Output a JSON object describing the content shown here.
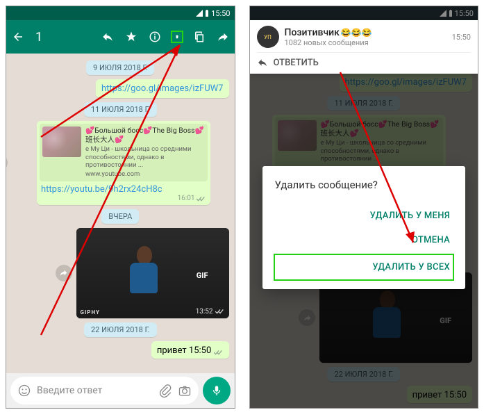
{
  "status": {
    "time": "15:50"
  },
  "appbar": {
    "selected_count": "1"
  },
  "dates": {
    "d1": "9 ИЮЛЯ 2018 Г.",
    "d2": "11 ИЮЛЯ 2018 Г.",
    "yesterday": "ВЧЕРА",
    "d3": "22 ИЮЛЯ 2018 Г."
  },
  "msgs": {
    "link1": "https://goo.gl/images/izFUW7",
    "preview": {
      "title": "💕Большой босс💕The Big Boss💕班长大人💕",
      "desc": "е Му Ци - школьница со средними способностями, однако в противостоянии ...",
      "site": "www.youtube.com",
      "link": "https://youtu.be/9h2rx24cH8c",
      "time": "16:01"
    },
    "gif": {
      "label": "GIF",
      "brand": "GIPHY",
      "time": "13:52"
    },
    "hello": {
      "text": "привет",
      "time": "15:50"
    }
  },
  "composer": {
    "placeholder": "Введите ответ"
  },
  "notif": {
    "title": "Позитивчик",
    "emoji": "😂😂😂",
    "sub": "1082 новых сообщения",
    "time": "15:50",
    "reply": "ОТВЕТИТЬ"
  },
  "dialog": {
    "title": "Удалить сообщение?",
    "del_me": "УДАЛИТЬ У МЕНЯ",
    "cancel": "ОТМЕНА",
    "del_all": "УДАЛИТЬ У ВСЕХ"
  }
}
